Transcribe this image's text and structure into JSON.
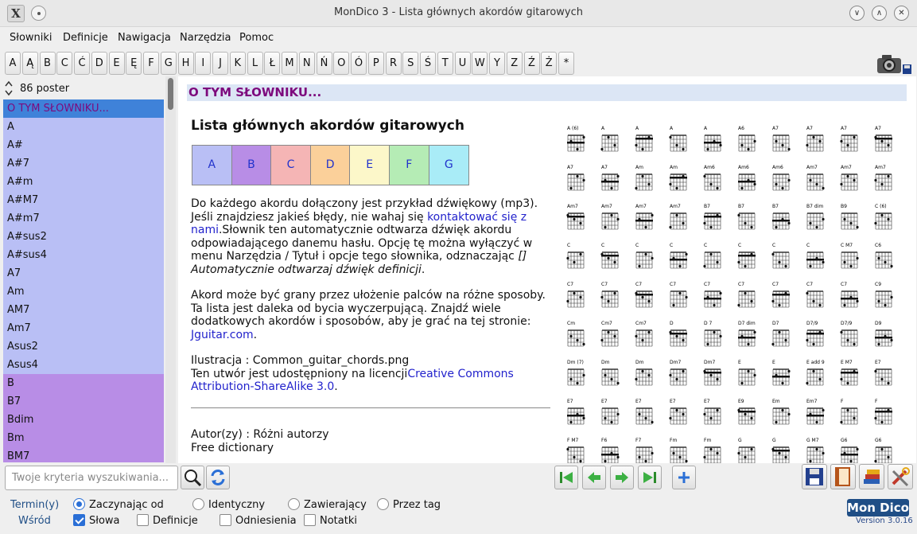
{
  "window": {
    "title": "MonDico 3 - Lista głównych akordów gitarowych"
  },
  "menu": [
    "Słowniki",
    "Definicje",
    "Nawigacja",
    "Narzędzia",
    "Pomoc"
  ],
  "letters": [
    "A",
    "Ą",
    "B",
    "C",
    "Ć",
    "D",
    "E",
    "Ę",
    "F",
    "G",
    "H",
    "I",
    "J",
    "K",
    "L",
    "Ł",
    "M",
    "N",
    "Ń",
    "O",
    "Ó",
    "P",
    "R",
    "S",
    "Ś",
    "T",
    "U",
    "W",
    "Y",
    "Z",
    "Ź",
    "Ż",
    "*"
  ],
  "sidebar": {
    "count": "86 poster",
    "items": [
      {
        "label": "O TYM SŁOWNIKU...",
        "state": "selected"
      },
      {
        "label": "A",
        "state": "a"
      },
      {
        "label": "A#",
        "state": "a"
      },
      {
        "label": "A#7",
        "state": "a"
      },
      {
        "label": "A#m",
        "state": "a"
      },
      {
        "label": "A#M7",
        "state": "a"
      },
      {
        "label": "A#m7",
        "state": "a"
      },
      {
        "label": "A#sus2",
        "state": "a"
      },
      {
        "label": "A#sus4",
        "state": "a"
      },
      {
        "label": "A7",
        "state": "a"
      },
      {
        "label": "Am",
        "state": "a"
      },
      {
        "label": "AM7",
        "state": "a"
      },
      {
        "label": "Am7",
        "state": "a"
      },
      {
        "label": "Asus2",
        "state": "a"
      },
      {
        "label": "Asus4",
        "state": "a"
      },
      {
        "label": "B",
        "state": "b"
      },
      {
        "label": "B7",
        "state": "b"
      },
      {
        "label": "Bdim",
        "state": "b"
      },
      {
        "label": "Bm",
        "state": "b"
      },
      {
        "label": "BM7",
        "state": "b"
      }
    ]
  },
  "content": {
    "section_header": "O TYM SŁOWNIKU...",
    "dict_title": "Lista głównych akordów gitarowych",
    "tabs": [
      {
        "label": "A",
        "color": "#b9bff5"
      },
      {
        "label": "B",
        "color": "#b88de6"
      },
      {
        "label": "C",
        "color": "#f5b5b5"
      },
      {
        "label": "D",
        "color": "#fbd09a"
      },
      {
        "label": "E",
        "color": "#fcf7c9"
      },
      {
        "label": "F",
        "color": "#b5ecb5"
      },
      {
        "label": "G",
        "color": "#a9ecf7"
      }
    ],
    "p1a": "Do każdego akordu dołączony jest przykład dźwiękowy (mp3). Jeśli znajdziesz jakieś błędy, nie wahaj się ",
    "p1_link": "kontaktować się z nami",
    "p1b": ".Słownik ten automatycznie odtwarza dźwięk akordu odpowiadającego danemu hasłu. Opcję tę można wyłączyć w menu Narzędzia / Tytuł i opcje tego słownika, odznaczając ",
    "p1_italic": "[] Automatycznie odtwarzaj dźwięk definicji",
    "p1c": ".",
    "p2a": "Akord może być grany przez ułożenie palców na różne sposoby. Ta lista jest daleka od bycia wyczerpującą. Znajdź wiele dodatkowych akordów i sposobów, aby je grać na tej stronie: ",
    "p2_link": "Jguitar.com",
    "p2b": ".",
    "p3a": "Ilustracja : Common_guitar_chords.png",
    "p3b": "Ten utwór jest udostępniony na licencji",
    "p3_link": "Creative Commons Attribution-ShareAlike 3.0",
    "p3c": ".",
    "author": "Autor(zy) : Różni autorzy",
    "license": "Free dictionary",
    "chord_names": [
      "A (6)",
      "A",
      "A",
      "A",
      "A",
      "A6",
      "A7",
      "A7",
      "A7",
      "A7",
      "A7",
      "A7",
      "Am",
      "Am",
      "Am6",
      "Am6",
      "Am6",
      "Am7",
      "Am7",
      "Am7",
      "Am7",
      "Am7",
      "Am7",
      "Am7",
      "B7",
      "B7",
      "B7",
      "B7 dim",
      "B9",
      "C (6)",
      "C",
      "C",
      "C",
      "C",
      "C",
      "C",
      "C",
      "C",
      "C M7",
      "C6",
      "C7",
      "C7",
      "C7",
      "C7",
      "C7",
      "C7",
      "C7",
      "C7",
      "C7",
      "C9",
      "Cm",
      "Cm7",
      "Cm7",
      "D",
      "D 7",
      "D7 dim",
      "D7",
      "D7/9",
      "D7/9",
      "D9",
      "Dm (7)",
      "Dm",
      "Dm",
      "Dm7",
      "Dm7",
      "E",
      "E",
      "E add 9",
      "E M7",
      "E7",
      "E7",
      "E7",
      "E7",
      "E7",
      "E7",
      "E9",
      "Em",
      "Em7",
      "F",
      "F",
      "F M7",
      "F6",
      "F7",
      "Fm",
      "Fm",
      "G",
      "G",
      "G M7",
      "G6",
      "G6"
    ]
  },
  "bottom": {
    "search_placeholder": "Twoje kryteria wyszukiwania...",
    "term_label": "Termin(y)",
    "where_label": "Wśród",
    "radios": [
      "Zaczynając od",
      "Identyczny",
      "Zawierający",
      "Przez tag"
    ],
    "checks": [
      "Słowa",
      "Definicje",
      "Odniesienia",
      "Notatki"
    ],
    "logo": "Mon Dico",
    "version": "Version 3.0.16"
  },
  "colors": {
    "selected": "#3f82d9",
    "a_bg": "#b9bff5",
    "b_bg": "#b88de6",
    "header_text": "#7d0a7d"
  }
}
